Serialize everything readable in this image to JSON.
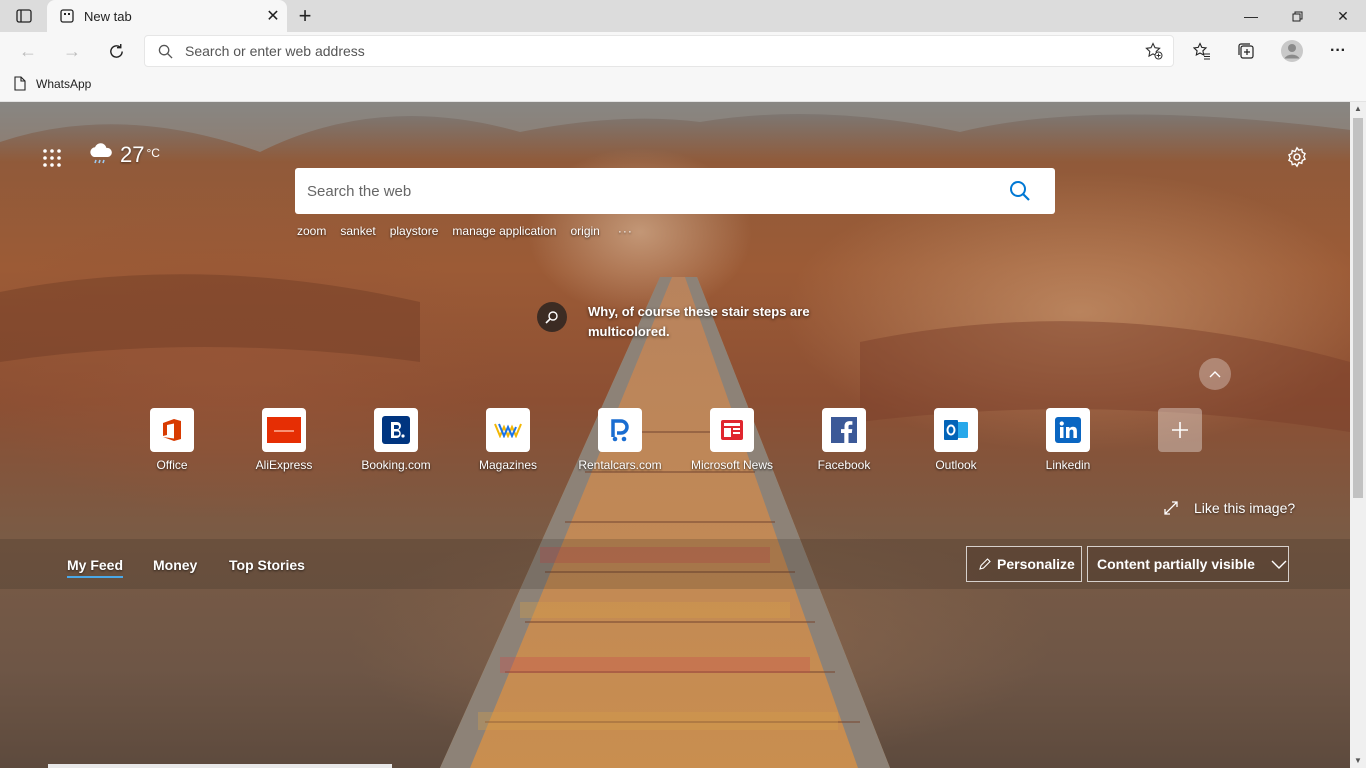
{
  "browser": {
    "tab_title": "New tab",
    "address_placeholder": "Search or enter web address",
    "bookmarks": [
      {
        "label": "WhatsApp"
      }
    ]
  },
  "newtab": {
    "weather": {
      "temperature": "27",
      "unit": "°C"
    },
    "search_placeholder": "Search the web",
    "suggestions": [
      "zoom",
      "sanket",
      "playstore",
      "manage application",
      "origin"
    ],
    "suggestions_more": "···",
    "image_trivia": "Why, of course these stair steps are multicolored.",
    "tiles": [
      {
        "label": "Office"
      },
      {
        "label": "AliExpress"
      },
      {
        "label": "Booking.com"
      },
      {
        "label": "Magazines"
      },
      {
        "label": "Rentalcars.com"
      },
      {
        "label": "Microsoft News"
      },
      {
        "label": "Facebook"
      },
      {
        "label": "Outlook"
      },
      {
        "label": "Linkedin"
      }
    ],
    "like_image": "Like this image?",
    "feed_tabs": [
      "My Feed",
      "Money",
      "Top Stories"
    ],
    "personalize": "Personalize",
    "content_visibility": "Content partially visible"
  },
  "colors": {
    "accent": "#0078d4",
    "feed_underline": "#4aa8e8"
  }
}
